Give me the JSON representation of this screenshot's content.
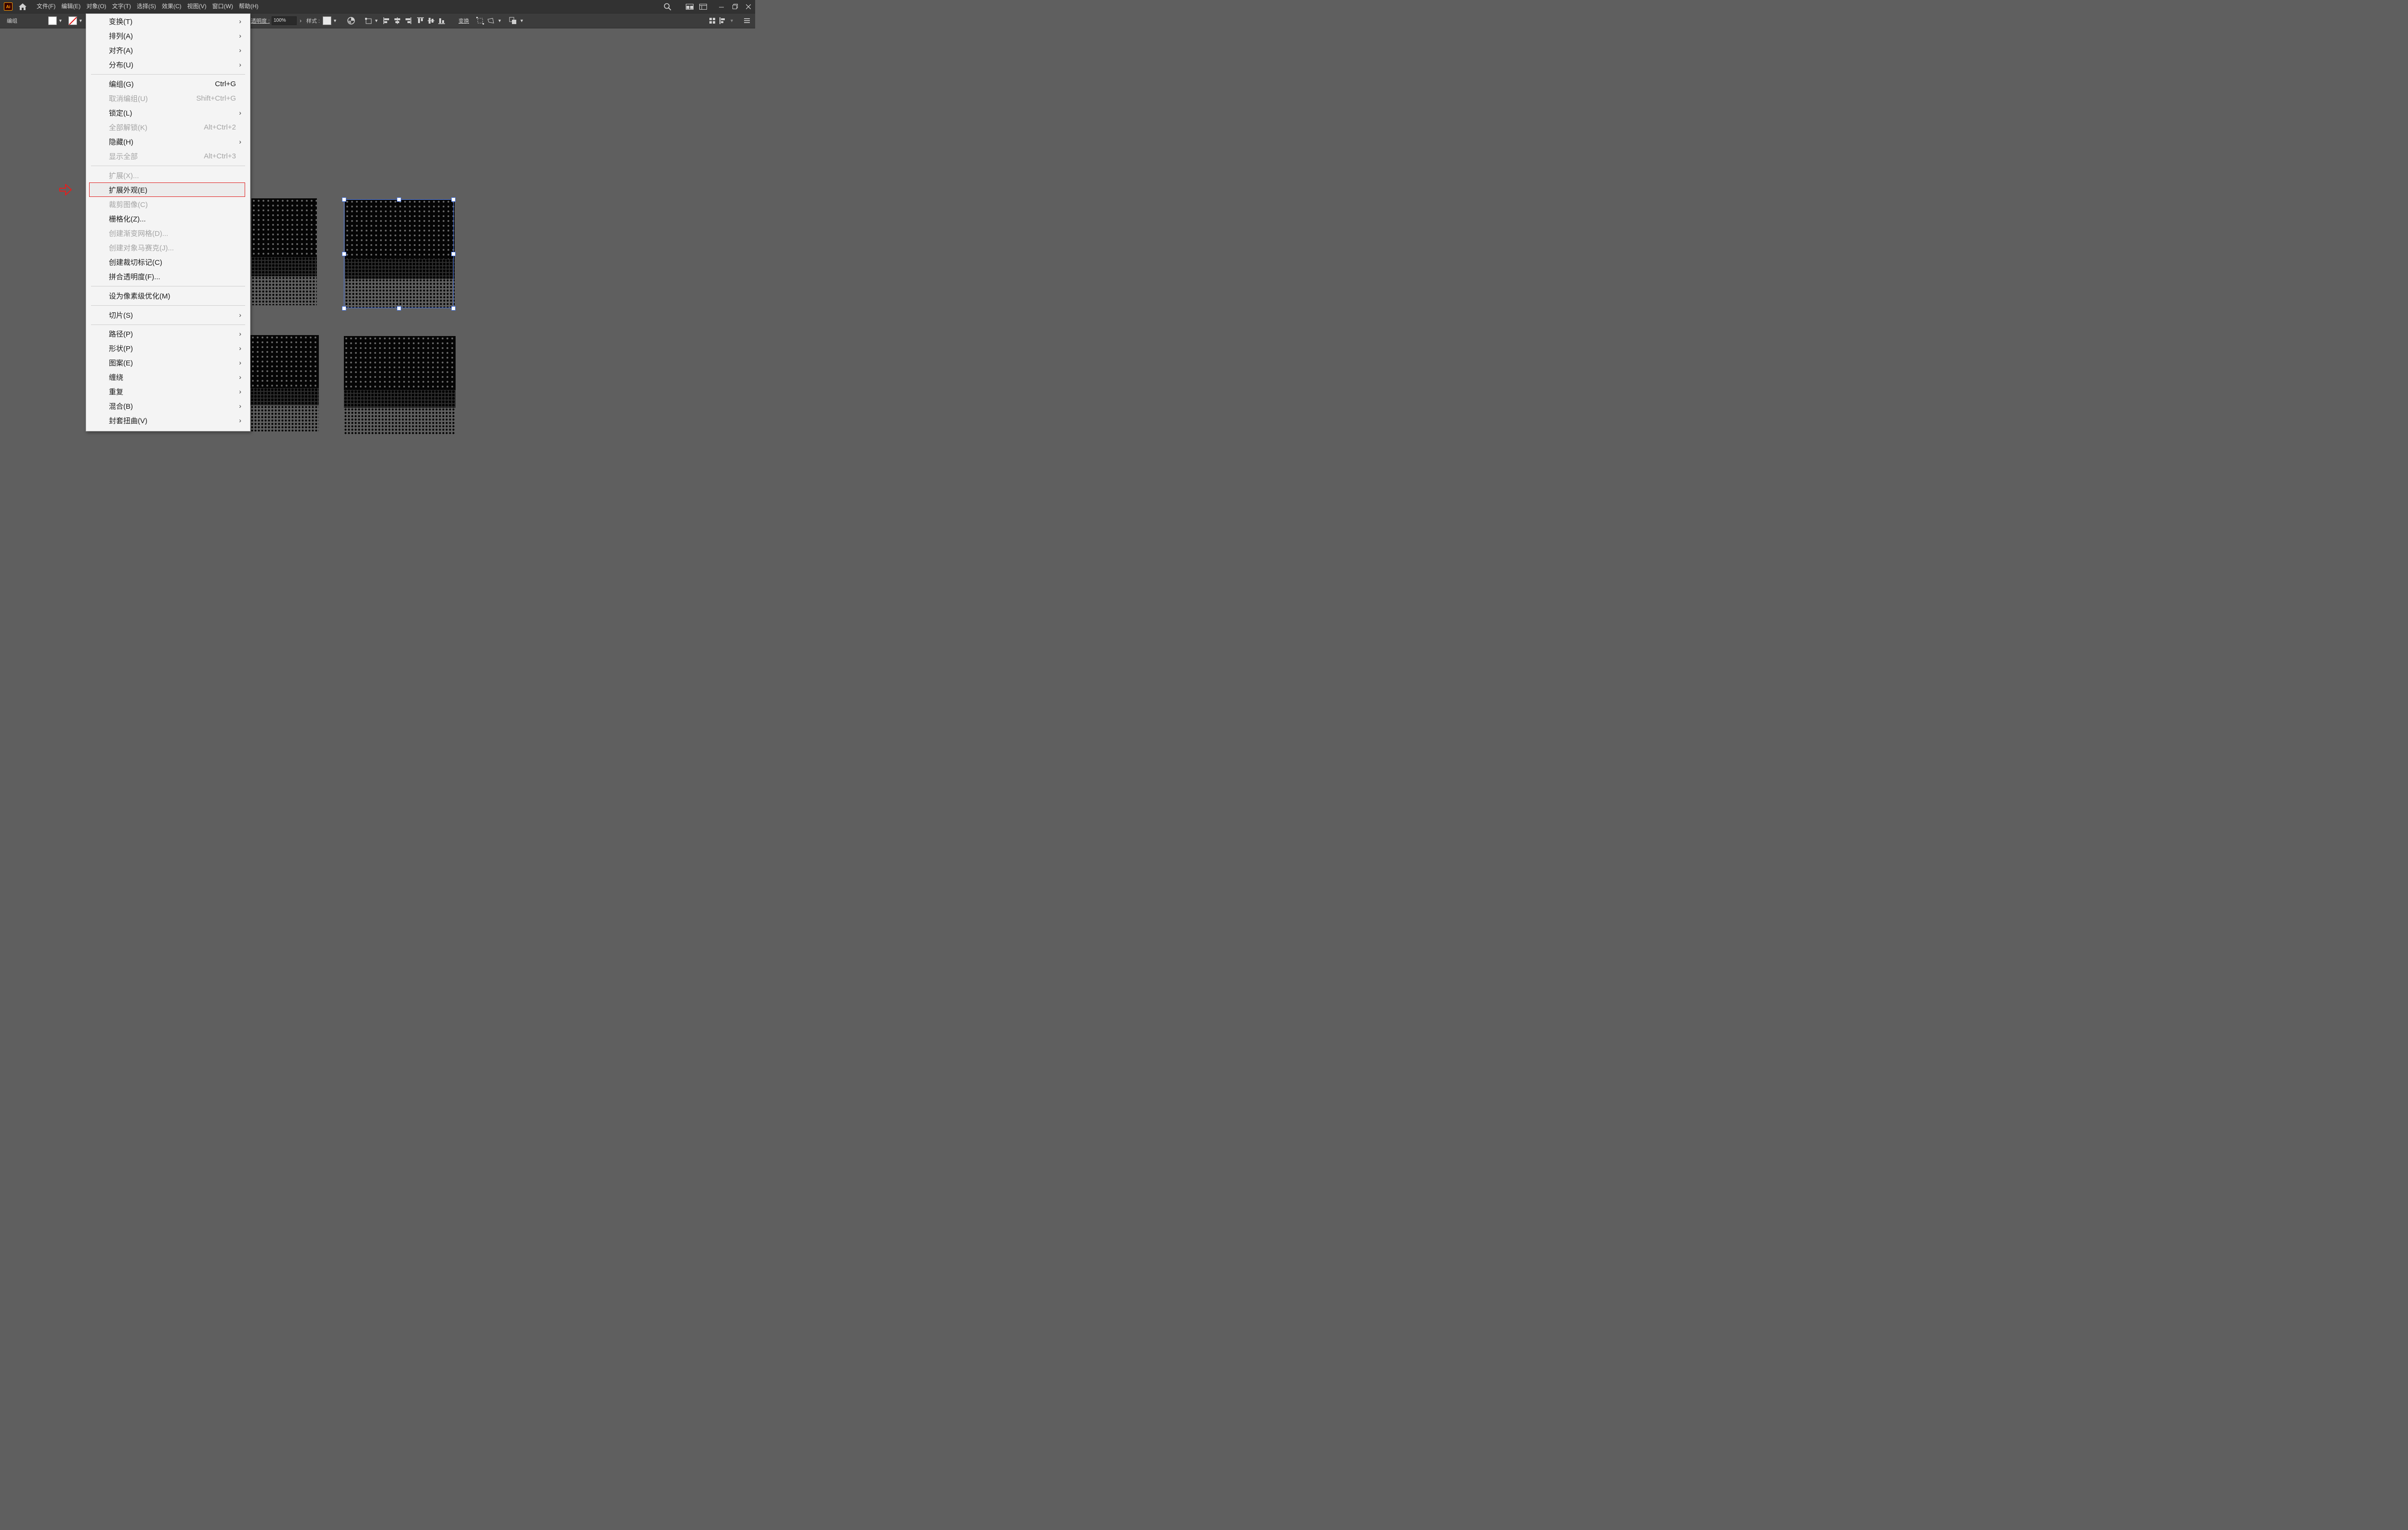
{
  "menubar": {
    "app_badge": "Ai",
    "items": [
      "文件(F)",
      "编辑(E)",
      "对象(O)",
      "文字(T)",
      "选择(S)",
      "效果(C)",
      "视图(V)",
      "窗口(W)",
      "帮助(H)"
    ]
  },
  "control_bar": {
    "selection_label": "编组",
    "opacity_label": "透明度 :",
    "opacity_value": "100%",
    "style_label": "样式 :",
    "transform_label": "变换"
  },
  "menu": {
    "items": [
      {
        "label": "变换(T)",
        "shortcut": "",
        "submenu": true,
        "disabled": false,
        "highlight": false
      },
      {
        "label": "排列(A)",
        "shortcut": "",
        "submenu": true,
        "disabled": false,
        "highlight": false
      },
      {
        "label": "对齐(A)",
        "shortcut": "",
        "submenu": true,
        "disabled": false,
        "highlight": false
      },
      {
        "label": "分布(U)",
        "shortcut": "",
        "submenu": true,
        "disabled": false,
        "highlight": false
      },
      {
        "label": "编组(G)",
        "shortcut": "Ctrl+G",
        "submenu": false,
        "disabled": false,
        "highlight": false
      },
      {
        "label": "取消编组(U)",
        "shortcut": "Shift+Ctrl+G",
        "submenu": false,
        "disabled": true,
        "highlight": false
      },
      {
        "label": "锁定(L)",
        "shortcut": "",
        "submenu": true,
        "disabled": false,
        "highlight": false
      },
      {
        "label": "全部解锁(K)",
        "shortcut": "Alt+Ctrl+2",
        "submenu": false,
        "disabled": true,
        "highlight": false
      },
      {
        "label": "隐藏(H)",
        "shortcut": "",
        "submenu": true,
        "disabled": false,
        "highlight": false
      },
      {
        "label": "显示全部",
        "shortcut": "Alt+Ctrl+3",
        "submenu": false,
        "disabled": true,
        "highlight": false
      },
      {
        "label": "扩展(X)...",
        "shortcut": "",
        "submenu": false,
        "disabled": true,
        "highlight": false
      },
      {
        "label": "扩展外观(E)",
        "shortcut": "",
        "submenu": false,
        "disabled": false,
        "highlight": true
      },
      {
        "label": "裁剪图像(C)",
        "shortcut": "",
        "submenu": false,
        "disabled": true,
        "highlight": false
      },
      {
        "label": "栅格化(Z)...",
        "shortcut": "",
        "submenu": false,
        "disabled": false,
        "highlight": false
      },
      {
        "label": "创建渐变网格(D)...",
        "shortcut": "",
        "submenu": false,
        "disabled": true,
        "highlight": false
      },
      {
        "label": "创建对象马赛克(J)...",
        "shortcut": "",
        "submenu": false,
        "disabled": true,
        "highlight": false
      },
      {
        "label": "创建裁切标记(C)",
        "shortcut": "",
        "submenu": false,
        "disabled": false,
        "highlight": false
      },
      {
        "label": "拼合透明度(F)...",
        "shortcut": "",
        "submenu": false,
        "disabled": false,
        "highlight": false
      },
      {
        "label": "设为像素级优化(M)",
        "shortcut": "",
        "submenu": false,
        "disabled": false,
        "highlight": false
      },
      {
        "label": "切片(S)",
        "shortcut": "",
        "submenu": true,
        "disabled": false,
        "highlight": false
      },
      {
        "label": "路径(P)",
        "shortcut": "",
        "submenu": true,
        "disabled": false,
        "highlight": false
      },
      {
        "label": "形状(P)",
        "shortcut": "",
        "submenu": true,
        "disabled": false,
        "highlight": false
      },
      {
        "label": "图案(E)",
        "shortcut": "",
        "submenu": true,
        "disabled": false,
        "highlight": false
      },
      {
        "label": "缠绕",
        "shortcut": "",
        "submenu": true,
        "disabled": false,
        "highlight": false
      },
      {
        "label": "重复",
        "shortcut": "",
        "submenu": true,
        "disabled": false,
        "highlight": false
      },
      {
        "label": "混合(B)",
        "shortcut": "",
        "submenu": true,
        "disabled": false,
        "highlight": false
      },
      {
        "label": "封套扭曲(V)",
        "shortcut": "",
        "submenu": true,
        "disabled": false,
        "highlight": false
      }
    ]
  },
  "colors": {
    "highlight_border": "#e02020",
    "selection": "#4a78e8",
    "canvas": "#5f5f5f"
  }
}
